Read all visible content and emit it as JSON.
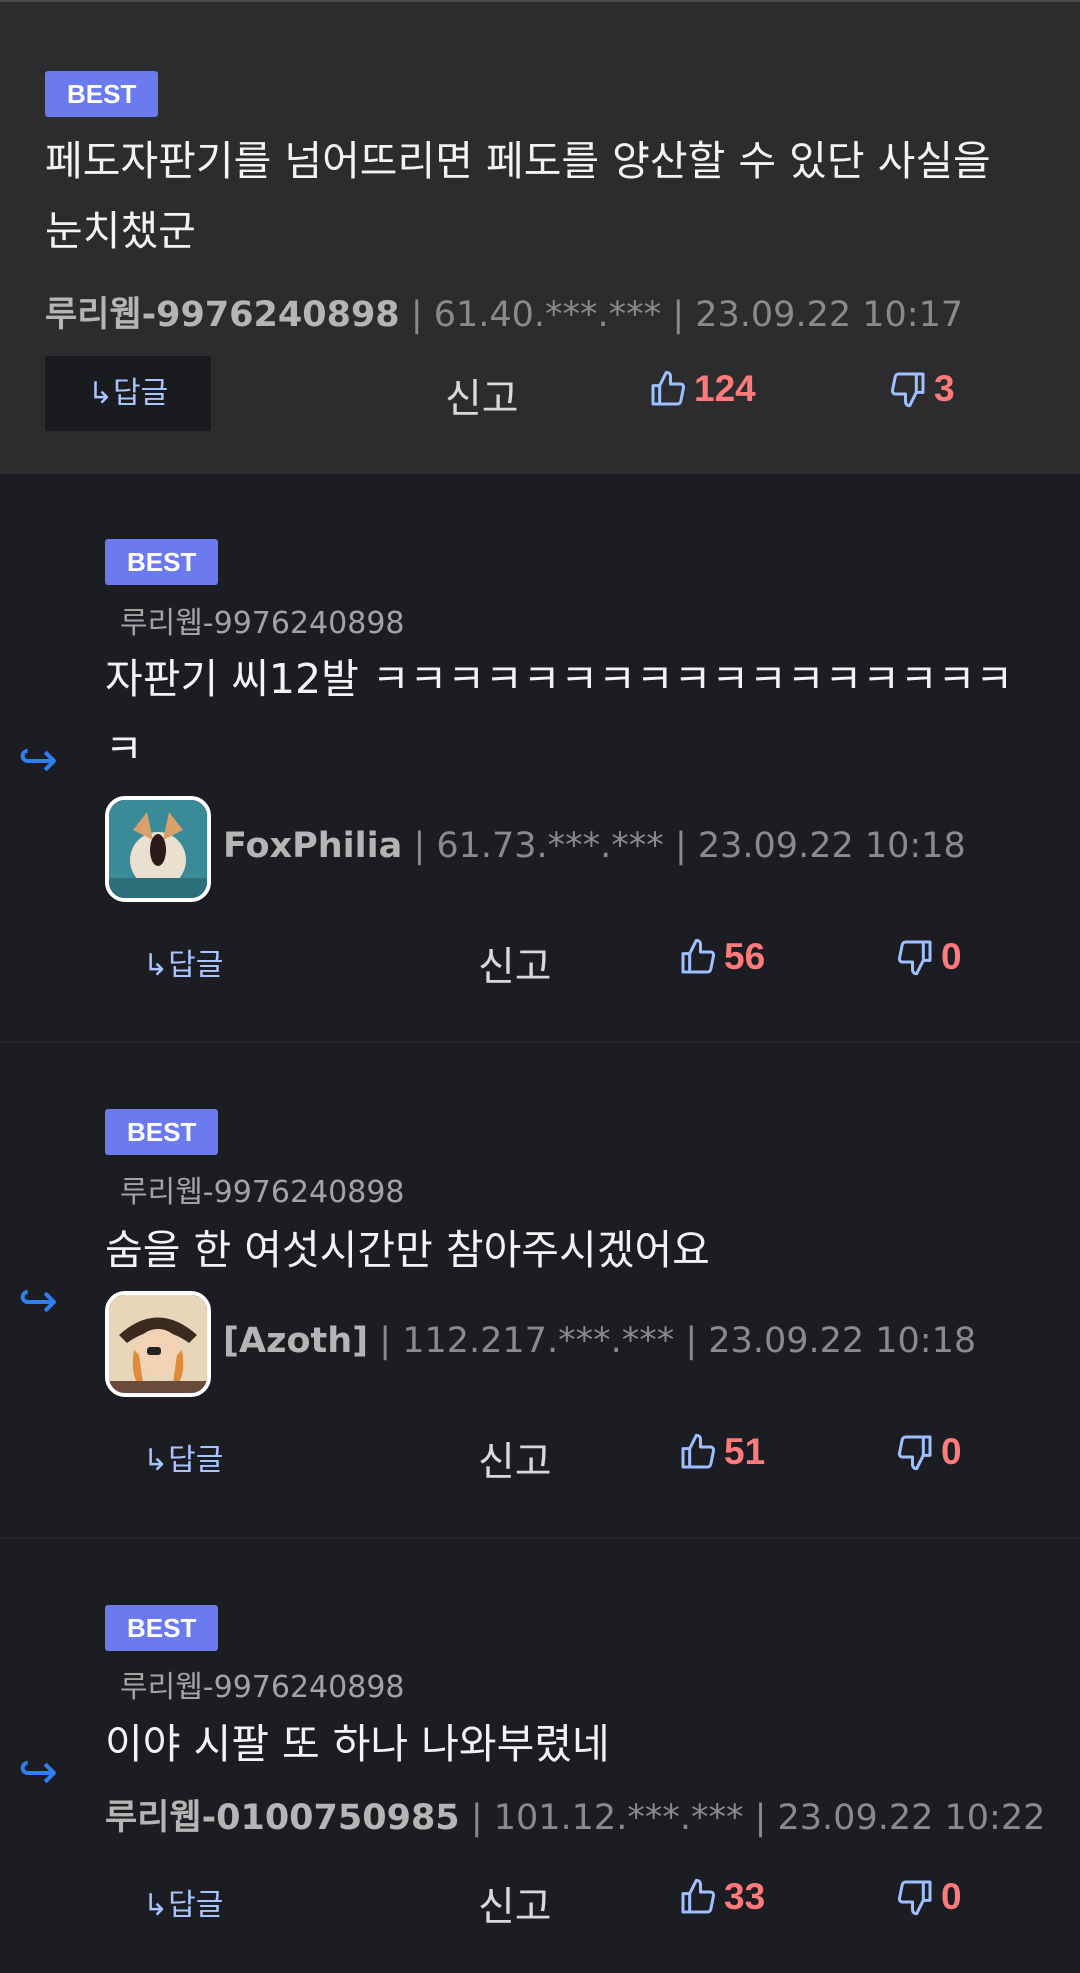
{
  "colors": {
    "accent_badge": "#6c7af0",
    "vote_count": "#ff7b7b",
    "reply_arrow": "#2f7ff0",
    "thumb": "#9fc0ff"
  },
  "comments": [
    {
      "badge": "BEST",
      "reply_to": "",
      "text": "페도자판기를 넘어뜨리면 페도를 양산할 수 있단 사실을 눈치챘군",
      "nickname": "루리웹-9976240898",
      "ip": "61.40.***.***",
      "time": "23.09.22 10:17",
      "reply_label": "↳답글",
      "report_label": "신고",
      "likes": "124",
      "dislikes": "3"
    },
    {
      "badge": "BEST",
      "reply_to": "루리웹-9976240898",
      "text": "자판기 씨12발 ㅋㅋㅋㅋㅋㅋㅋㅋㅋㅋㅋㅋㅋㅋㅋㅋㅋㅋ",
      "nickname": "FoxPhilia",
      "ip": "61.73.***.***",
      "time": "23.09.22 10:18",
      "reply_label": "↳답글",
      "report_label": "신고",
      "likes": "56",
      "dislikes": "0"
    },
    {
      "badge": "BEST",
      "reply_to": "루리웹-9976240898",
      "text": "숨을 한 여섯시간만 참아주시겠어요",
      "nickname": "[Azoth]",
      "ip": "112.217.***.***",
      "time": "23.09.22 10:18",
      "reply_label": "↳답글",
      "report_label": "신고",
      "likes": "51",
      "dislikes": "0"
    },
    {
      "badge": "BEST",
      "reply_to": "루리웹-9976240898",
      "text": "이야 시팔 또 하나 나와부렸네",
      "nickname": "루리웹-0100750985",
      "ip": "101.12.***.***",
      "time": "23.09.22 10:22",
      "reply_label": "↳답글",
      "report_label": "신고",
      "likes": "33",
      "dislikes": "0"
    }
  ]
}
